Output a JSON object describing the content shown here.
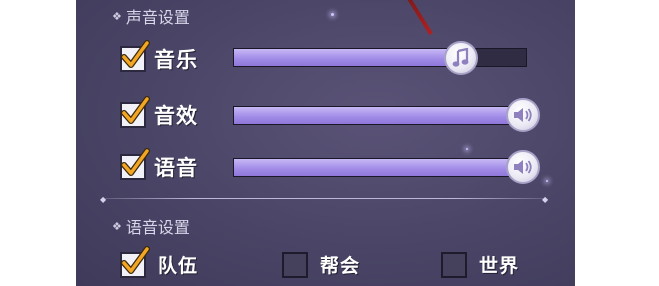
{
  "sound_settings": {
    "title": "声音设置",
    "rows": [
      {
        "label": "音乐",
        "checked": true,
        "level": 0.79,
        "knob_icon": "music-note-icon"
      },
      {
        "label": "音效",
        "checked": true,
        "level": 1.0,
        "knob_icon": "speaker-icon"
      },
      {
        "label": "语音",
        "checked": true,
        "level": 1.0,
        "knob_icon": "speaker-icon"
      }
    ]
  },
  "voice_settings": {
    "title": "语音设置",
    "channels": [
      {
        "label": "队伍",
        "checked": true
      },
      {
        "label": "帮会",
        "checked": false
      },
      {
        "label": "世界",
        "checked": false
      }
    ]
  },
  "colors": {
    "panel_bg": "#4a4566",
    "slider_fill": "#a08ae6",
    "check_mark": "#f3a623"
  }
}
